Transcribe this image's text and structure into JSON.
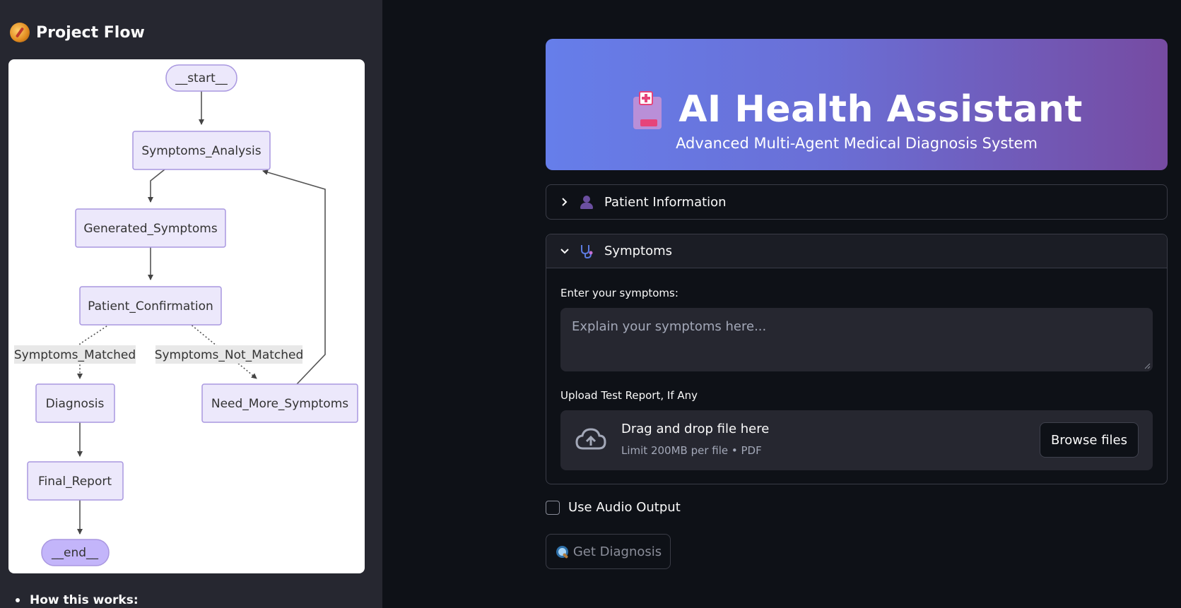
{
  "sidebar": {
    "title": "Project Flow",
    "title_icon": "compass-icon",
    "graph": {
      "nodes": {
        "start": "__start__",
        "symptoms_analysis": "Symptoms_Analysis",
        "generated_symptoms": "Generated_Symptoms",
        "patient_confirmation": "Patient_Confirmation",
        "diagnosis": "Diagnosis",
        "need_more_symptoms": "Need_More_Symptoms",
        "final_report": "Final_Report",
        "end": "__end__"
      },
      "edge_labels": {
        "matched": "Symptoms_Matched",
        "not_matched": "Symptoms_Not_Matched"
      }
    },
    "how_it_works": "How this works:"
  },
  "hero": {
    "icon": "hospital-icon",
    "title": "AI Health Assistant",
    "subtitle": "Advanced Multi-Agent Medical Diagnosis System"
  },
  "patient_info": {
    "label": "Patient Information",
    "icon": "person-icon",
    "expanded": false
  },
  "symptoms": {
    "label": "Symptoms",
    "icon": "stethoscope-icon",
    "expanded": true,
    "input_label": "Enter your symptoms:",
    "input_placeholder": "Explain your symptoms here...",
    "upload_label": "Upload Test Report, If Any",
    "upload_main": "Drag and drop file here",
    "upload_sub": "Limit 200MB per file • PDF",
    "browse_label": "Browse files"
  },
  "audio": {
    "label": "Use Audio Output",
    "checked": false
  },
  "diagnosis_button": {
    "label": "Get Diagnosis",
    "icon": "magnifier-icon"
  },
  "colors": {
    "background": "#0e1117",
    "sidebar": "#262730",
    "hero_start": "#667eea",
    "hero_end": "#764ba2",
    "node_fill": "#ece8fb",
    "end_node_fill": "#c3b5fa"
  }
}
